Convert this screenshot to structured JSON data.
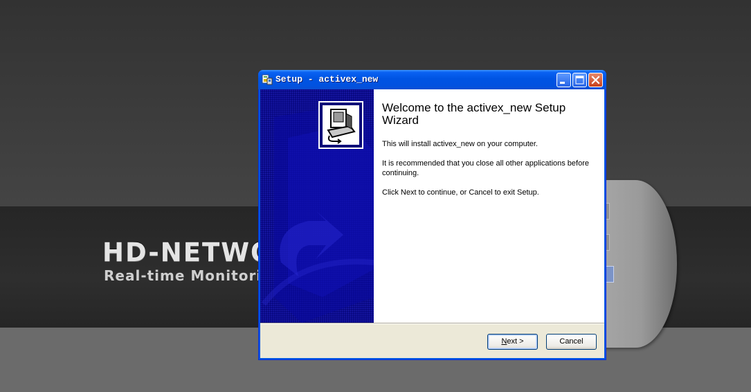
{
  "background_page": {
    "brand_title": "HD-NETWO",
    "brand_subtitle": "Real-time Monitorin"
  },
  "window": {
    "title": "Setup - activex_new",
    "controls": {
      "minimize_icon": "minimize-icon",
      "maximize_icon": "maximize-icon",
      "close_icon": "close-icon"
    }
  },
  "wizard": {
    "heading": "Welcome to the activex_new Setup Wizard",
    "paragraphs": [
      "This will install activex_new on your computer.",
      "It is recommended that you close all other applications before continuing.",
      "Click Next to continue, or Cancel to exit Setup."
    ],
    "buttons": {
      "next_label_mnemonic": "N",
      "next_label_rest": "ext >",
      "cancel_label": "Cancel"
    }
  },
  "colors": {
    "titlebar": "#0054e3",
    "side_panel": "#040478",
    "button_border": "#003c74"
  }
}
